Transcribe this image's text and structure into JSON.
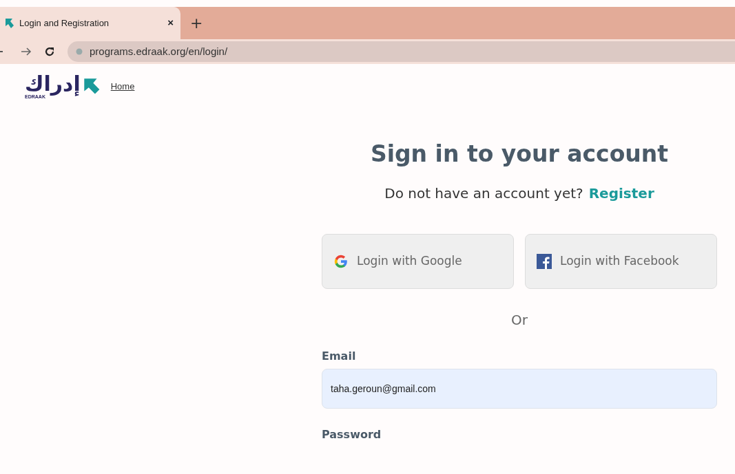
{
  "browser": {
    "tab": {
      "title": "Login and Registration",
      "close": "×"
    },
    "new_tab": "+",
    "url": "programs.edraak.org/en/login/"
  },
  "header": {
    "logo": {
      "arabic": "إدراك",
      "latin": "EDRAAK"
    },
    "home_link": "Home"
  },
  "login": {
    "title": "Sign in to your account",
    "register_prompt": "Do not have an account yet?",
    "register_link": "Register",
    "social_buttons": [
      {
        "kind": "google",
        "label": "Login with Google"
      },
      {
        "kind": "facebook",
        "label": "Login with Facebook"
      }
    ],
    "separator": "Or",
    "fields": [
      {
        "label": "Email",
        "value": "taha.geroun@gmail.com"
      },
      {
        "label": "Password"
      }
    ]
  }
}
